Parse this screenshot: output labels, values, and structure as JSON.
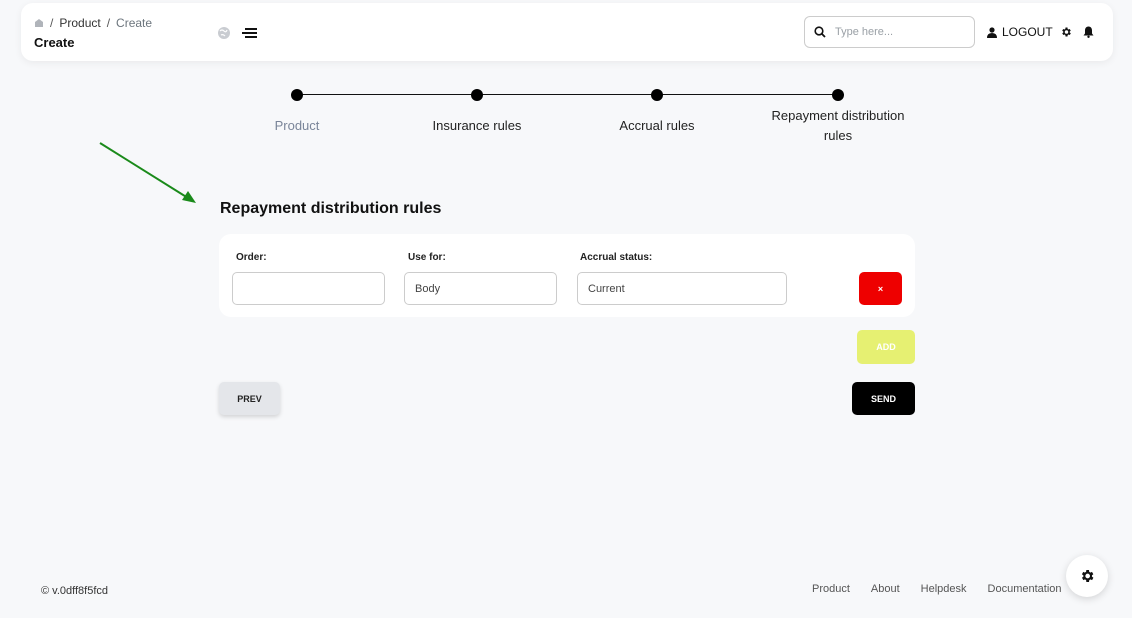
{
  "header": {
    "breadcrumb": [
      "Product",
      "Create"
    ],
    "breadcrumb_sep": "/",
    "page_title": "Create",
    "search_placeholder": "Type here...",
    "logout_label": "LOGOUT",
    "icons": [
      "home-icon",
      "globe-icon",
      "menu-icon",
      "search-icon",
      "user-icon",
      "gear-icon",
      "bell-icon"
    ]
  },
  "stepper": {
    "steps": [
      "Product",
      "Insurance rules",
      "Accrual rules",
      "Repayment distribution rules"
    ],
    "active_step": "Product"
  },
  "section": {
    "title": "Repayment distribution rules"
  },
  "rule": {
    "order_label": "Order:",
    "order_value": "",
    "use_for_label": "Use for:",
    "use_for_value": "Body",
    "accrual_status_label": "Accrual status:",
    "accrual_status_value": "Current",
    "delete_label": "×"
  },
  "actions": {
    "add_label": "ADD",
    "prev_label": "PREV",
    "send_label": "SEND"
  },
  "footer": {
    "version": "© v.0dff8f5fcd",
    "links": [
      "Product",
      "About",
      "Helpdesk",
      "Documentation"
    ]
  },
  "colors": {
    "delete": "#ee0000",
    "add": "#e6f072",
    "send": "#000000",
    "arrow": "#1a8a1a"
  }
}
